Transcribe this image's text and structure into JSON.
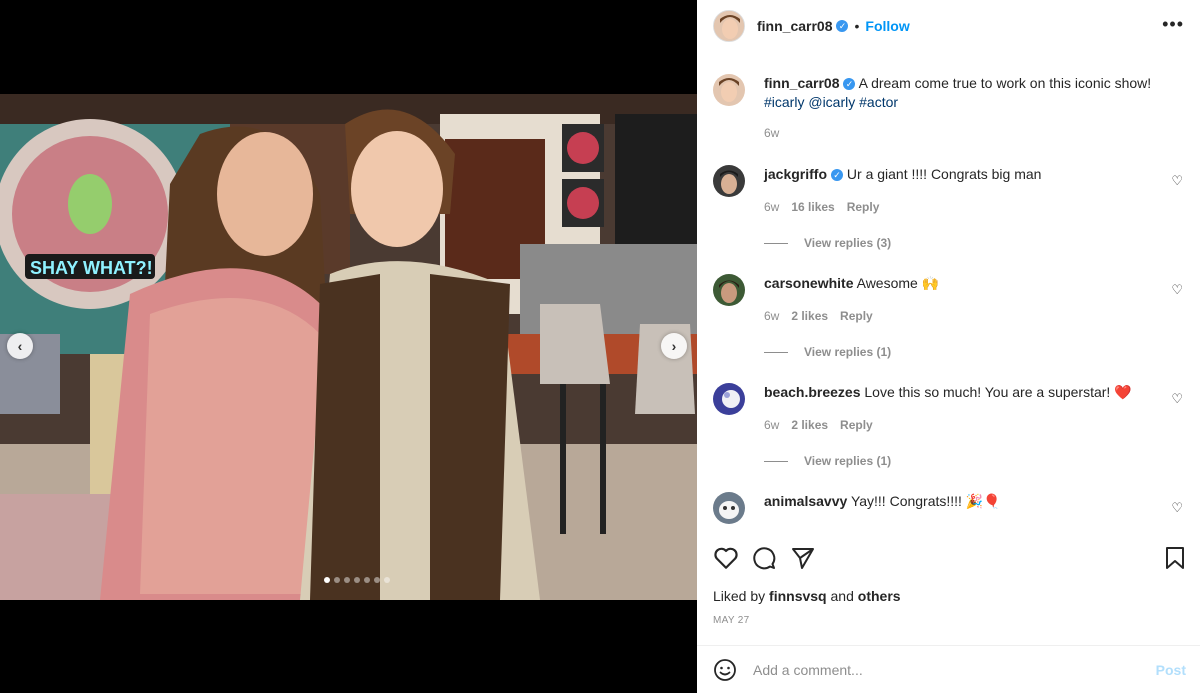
{
  "post": {
    "author": "finn_carr08",
    "follow_label": "Follow",
    "separator": "•",
    "more_icon": "more-horizontal-icon"
  },
  "caption": {
    "user": "finn_carr08",
    "text": "A dream come true to work on this iconic show!",
    "tags": [
      "#icarly",
      "@icarly",
      "#actor"
    ],
    "time": "6w"
  },
  "comments": [
    {
      "user": "jackgriffo",
      "verified": true,
      "text": "Ur a giant !!!! Congrats big man",
      "time": "6w",
      "likes": "16 likes",
      "reply": "Reply",
      "view_replies": "View replies (3)"
    },
    {
      "user": "carsonewhite",
      "verified": false,
      "text": "Awesome 🙌",
      "time": "6w",
      "likes": "2 likes",
      "reply": "Reply",
      "view_replies": "View replies (1)"
    },
    {
      "user": "beach.breezes",
      "verified": false,
      "text": "Love this so much! You are a superstar! ❤️",
      "time": "6w",
      "likes": "2 likes",
      "reply": "Reply",
      "view_replies": "View replies (1)"
    },
    {
      "user": "animalsavvy",
      "verified": false,
      "text": "Yay!!! Congrats!!!! 🎉🎈"
    }
  ],
  "liked_by": {
    "prefix": "Liked by",
    "user": "finnsvsq",
    "and": "and",
    "others": "others"
  },
  "date": "MAY 27",
  "add_comment": {
    "placeholder": "Add a comment...",
    "post_label": "Post"
  },
  "media": {
    "photo_text": "SHAY WHAT?!",
    "slides": 7,
    "active_slide": 1
  }
}
